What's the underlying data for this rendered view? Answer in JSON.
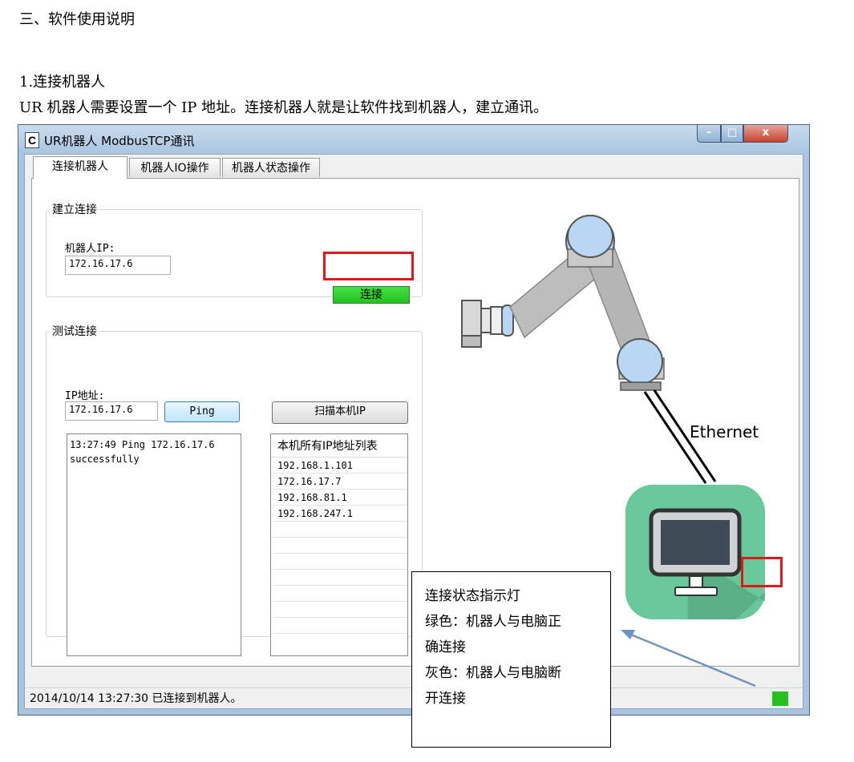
{
  "doc": {
    "section_heading": "三、软件使用说明",
    "subheading": "1.连接机器人",
    "paragraph": "UR 机器人需要设置一个 IP 地址。连接机器人就是让软件找到机器人，建立通讯。"
  },
  "window": {
    "app_icon": "C",
    "title": "UR机器人 ModbusTCP通讯",
    "controls": {
      "minimize": "–",
      "maximize": "□",
      "close": "x"
    }
  },
  "tabs": [
    {
      "label": "连接机器人"
    },
    {
      "label": "机器人IO操作"
    },
    {
      "label": "机器人状态操作"
    }
  ],
  "connect_group": {
    "legend": "建立连接",
    "ip_label": "机器人IP:",
    "ip_value": "172.16.17.6",
    "connect_button": "连接"
  },
  "test_group": {
    "legend": "测试连接",
    "ip_label": "IP地址:",
    "ip_value": "172.16.17.6",
    "ping_button": "Ping",
    "scan_button": "扫描本机IP",
    "log_lines": [
      "13:27:49  Ping 172.16.17.6",
      "successfully"
    ],
    "ip_list_header": "本机所有IP地址列表",
    "ip_list": [
      "192.168.1.101",
      "172.16.17.7",
      "192.168.81.1",
      "192.168.247.1"
    ]
  },
  "diagram": {
    "ethernet_label": "Ethernet"
  },
  "statusbar": {
    "text": "2014/10/14 13:27:30  已连接到机器人。"
  },
  "callout": {
    "lines": [
      "连接状态指示灯",
      "绿色：机器人与电脑正",
      "确连接",
      "灰色：机器人与电脑断",
      "开连接"
    ]
  },
  "colors": {
    "led_connected": "#25c21f",
    "highlight": "#e0181a",
    "connect_button": "#21c31e"
  }
}
